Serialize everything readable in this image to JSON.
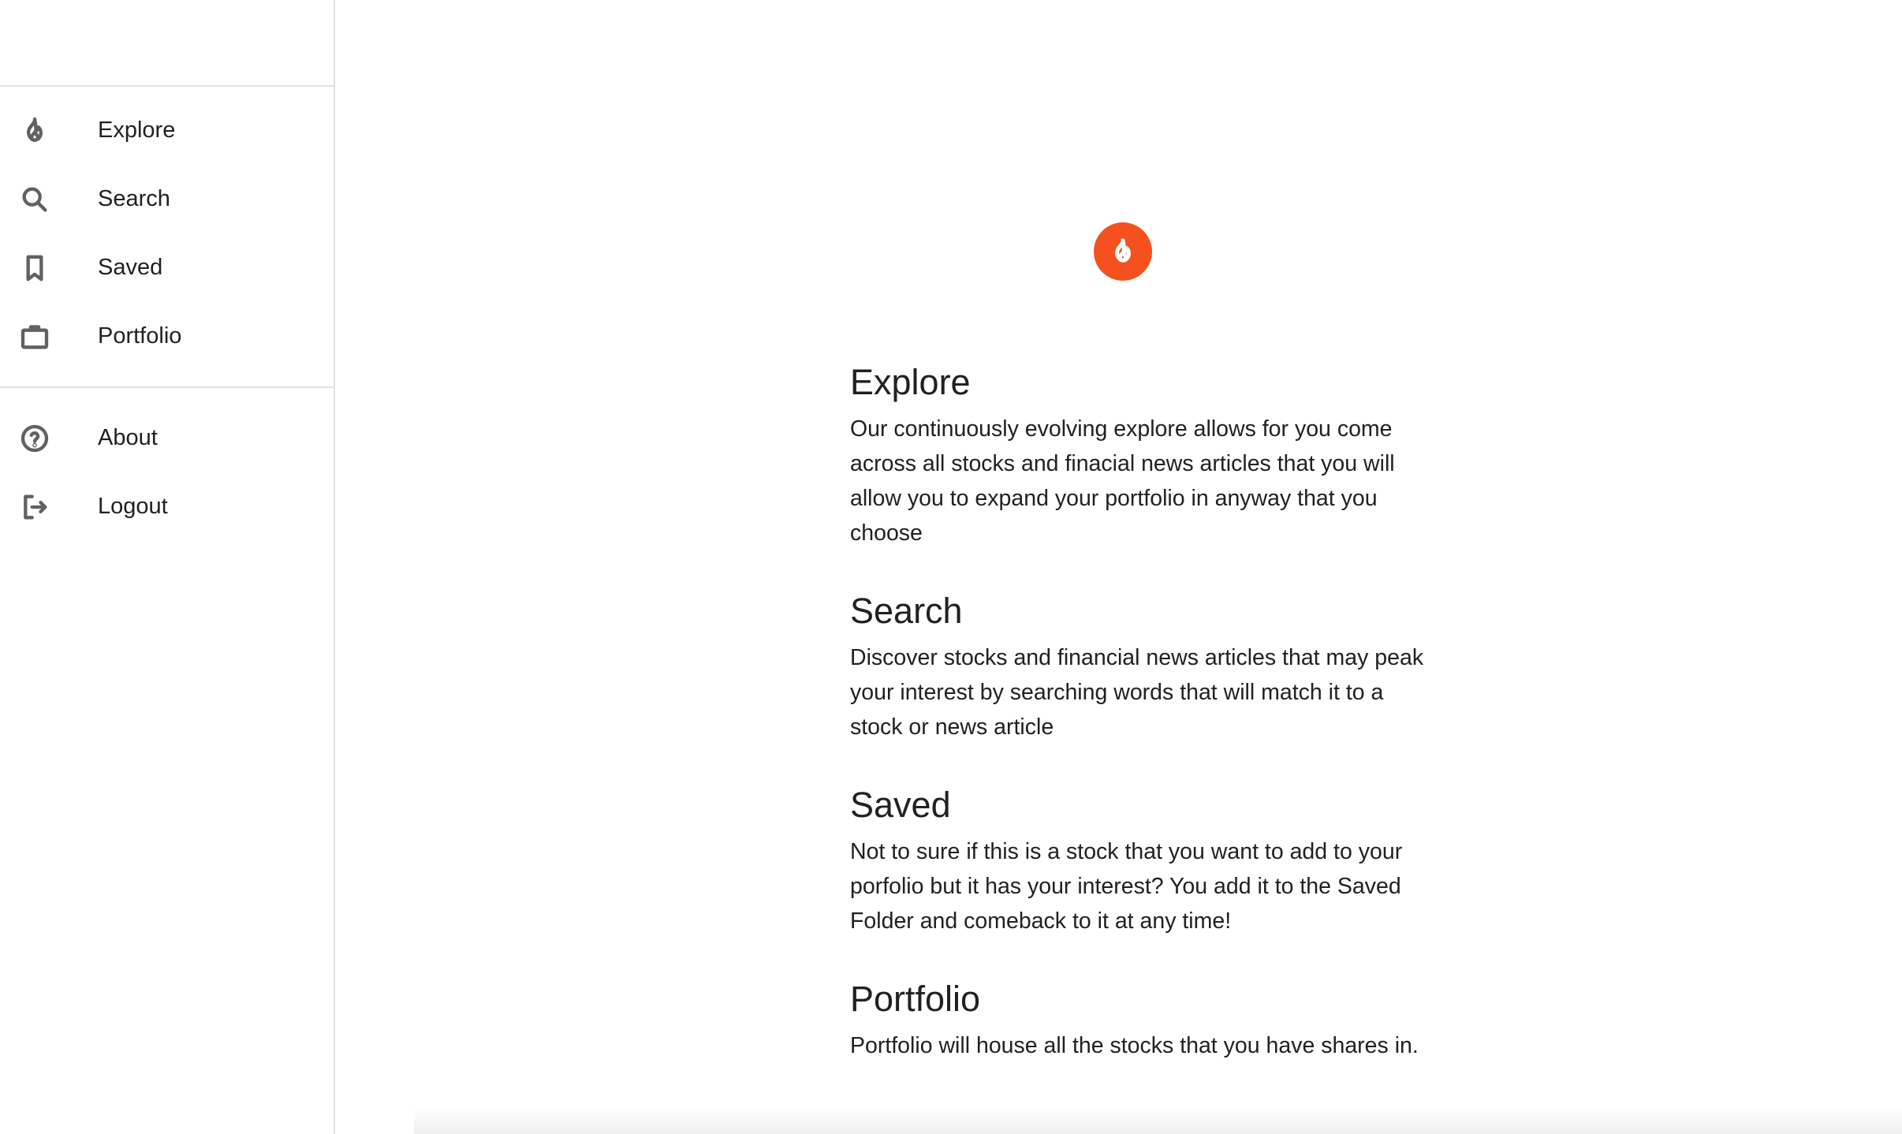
{
  "sidebar": {
    "nav_primary": [
      {
        "label": "Explore",
        "icon": "flame-icon"
      },
      {
        "label": "Search",
        "icon": "search-icon"
      },
      {
        "label": "Saved",
        "icon": "bookmark-icon"
      },
      {
        "label": "Portfolio",
        "icon": "briefcase-icon"
      }
    ],
    "nav_secondary": [
      {
        "label": "About",
        "icon": "help-circle-icon"
      },
      {
        "label": "Logout",
        "icon": "logout-icon"
      }
    ]
  },
  "main": {
    "brand_icon": "flame-icon",
    "brand_color": "#f4511e",
    "sections": [
      {
        "title": "Explore",
        "text": "Our continuously evolving explore allows for you come across all stocks and finacial news articles that you will allow you to expand your portfolio in anyway that you choose"
      },
      {
        "title": "Search",
        "text": "Discover stocks and financial news articles that may peak your interest by searching words that will match it to a stock or news article"
      },
      {
        "title": "Saved",
        "text": "Not to sure if this is a stock that you want to add to your porfolio but it has your interest? You add it to the Saved Folder and comeback to it at any time!"
      },
      {
        "title": "Portfolio",
        "text": "Portfolio will house all the stocks that you have shares in."
      }
    ]
  }
}
